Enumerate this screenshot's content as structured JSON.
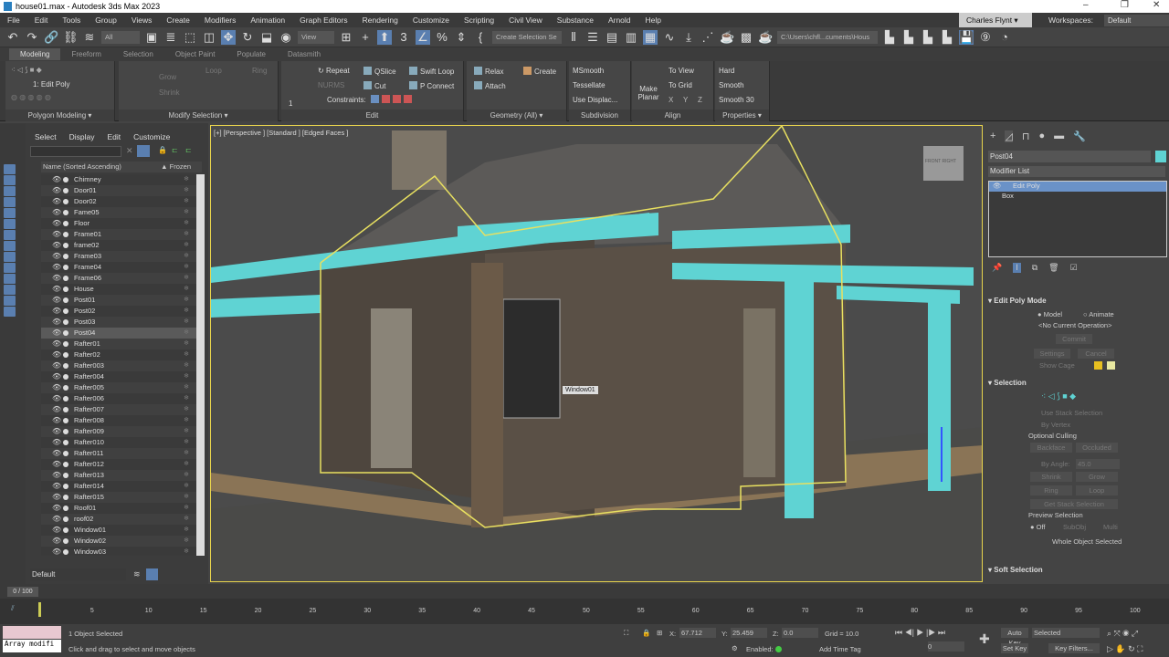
{
  "window": {
    "title": "house01.max - Autodesk 3ds Max 2023",
    "minimize": "–",
    "restore": "❐",
    "close": "✕"
  },
  "menu": [
    "File",
    "Edit",
    "Tools",
    "Group",
    "Views",
    "Create",
    "Modifiers",
    "Animation",
    "Graph Editors",
    "Rendering",
    "Customize",
    "Scripting",
    "Civil View",
    "Substance",
    "Arnold",
    "Help"
  ],
  "user": "Charles Flynt ▾",
  "workspaces": {
    "label": "Workspaces:",
    "value": "Default"
  },
  "toolbar": {
    "filter": "All",
    "refcoord": "View",
    "selset": "Create Selection Se",
    "path": "C:\\Users\\chfl...cuments\\Hous"
  },
  "ribbon": {
    "tabs": [
      "Modeling",
      "Freeform",
      "Selection",
      "Object Paint",
      "Populate",
      "Datasmith"
    ],
    "groups": {
      "polygon_modeling": "Polygon Modeling ▾",
      "modify_selection": "Modify Selection ▾",
      "edit": "Edit",
      "geometry": "Geometry (All) ▾",
      "subdivision": "Subdivision",
      "align": "Align",
      "properties": "Properties ▾"
    },
    "stack": "1: Edit Poly",
    "grow": "Grow",
    "shrink": "Shrink",
    "loop": "Loop",
    "ring": "Ring",
    "spin": "1",
    "repeat": "Repeat",
    "qslice": "QSlice",
    "swift_loop": "Swift Loop",
    "nurms": "NURMS",
    "cut": "Cut",
    "p_connect": "P Connect",
    "constraints": "Constraints:",
    "relax": "Relax",
    "create": "Create",
    "attach": "Attach",
    "msmooth": "MSmooth",
    "tessellate": "Tessellate",
    "use_displac": "Use Displac...",
    "make_planar": "Make Planar",
    "to_view": "To View",
    "to_grid": "To Grid",
    "x": "X",
    "y": "Y",
    "z": "Z",
    "hard": "Hard",
    "smooth": "Smooth",
    "smooth30": "Smooth 30"
  },
  "explorer": {
    "menu": [
      "Select",
      "Display",
      "Edit",
      "Customize"
    ],
    "col_name": "Name (Sorted Ascending)",
    "col_frozen": "▲ Frozen",
    "selected": "Post04",
    "items": [
      "Chimney",
      "Door01",
      "Door02",
      "Fame05",
      "Floor",
      "Frame01",
      "frame02",
      "Frame03",
      "Frame04",
      "Frame06",
      "House",
      "Post01",
      "Post02",
      "Post03",
      "Post04",
      "Rafter01",
      "Rafter02",
      "Rafter003",
      "Rafter004",
      "Rafter005",
      "Rafter006",
      "Rafter007",
      "Rafter008",
      "Rafter009",
      "Rafter010",
      "Rafter011",
      "Rafter012",
      "Rafter013",
      "Rafter014",
      "Rafter015",
      "Roof01",
      "roof02",
      "Window01",
      "Window02",
      "Window03"
    ],
    "layer": "Default"
  },
  "viewport": {
    "label": "[+] [Perspective ] [Standard ] [Edged Faces ]",
    "tooltip": "Window01",
    "viewcube": "FRONT  RIGHT"
  },
  "command": {
    "object_name": "Post04",
    "object_color": "#5fd3d3",
    "modifier_list": "Modifier List",
    "stack": [
      "Edit Poly",
      "Box"
    ],
    "edit_poly_mode": {
      "title": "Edit Poly Mode",
      "model": "Model",
      "animate": "Animate",
      "operation": "<No Current Operation>",
      "commit": "Commit",
      "settings": "Settings",
      "cancel": "Cancel",
      "show_cage": "Show Cage"
    },
    "selection": {
      "title": "Selection",
      "use_stack": "Use Stack Selection",
      "by_vertex": "By Vertex",
      "optional_culling": "Optional Culling",
      "backface": "Backface",
      "occluded": "Occluded",
      "by_angle": "By Angle:",
      "angle": "45.0",
      "shrink": "Shrink",
      "grow": "Grow",
      "ring": "Ring",
      "loop": "Loop",
      "get_stack": "Get Stack Selection",
      "preview": "Preview Selection",
      "off": "Off",
      "subobj": "SubObj",
      "multi": "Multi",
      "status": "Whole Object Selected"
    },
    "soft_selection": "Soft Selection"
  },
  "timeline": {
    "frame": "0 / 100",
    "ticks": [
      "0",
      "5",
      "10",
      "15",
      "20",
      "25",
      "30",
      "35",
      "40",
      "45",
      "50",
      "55",
      "60",
      "65",
      "70",
      "75",
      "80",
      "85",
      "90",
      "95",
      "100"
    ]
  },
  "status": {
    "script": "Array modifi",
    "selected": "1 Object Selected",
    "prompt": "Click and drag to select and move objects",
    "x": "67.712",
    "y": "25.459",
    "z": "0.0",
    "grid": "Grid = 10.0",
    "enabled": "Enabled:",
    "add_time_tag": "Add Time Tag",
    "auto_key": "Auto Key",
    "set_key": "Set Key",
    "key_mode": "Selected",
    "key_filters": "Key Filters...",
    "frame": "0"
  }
}
